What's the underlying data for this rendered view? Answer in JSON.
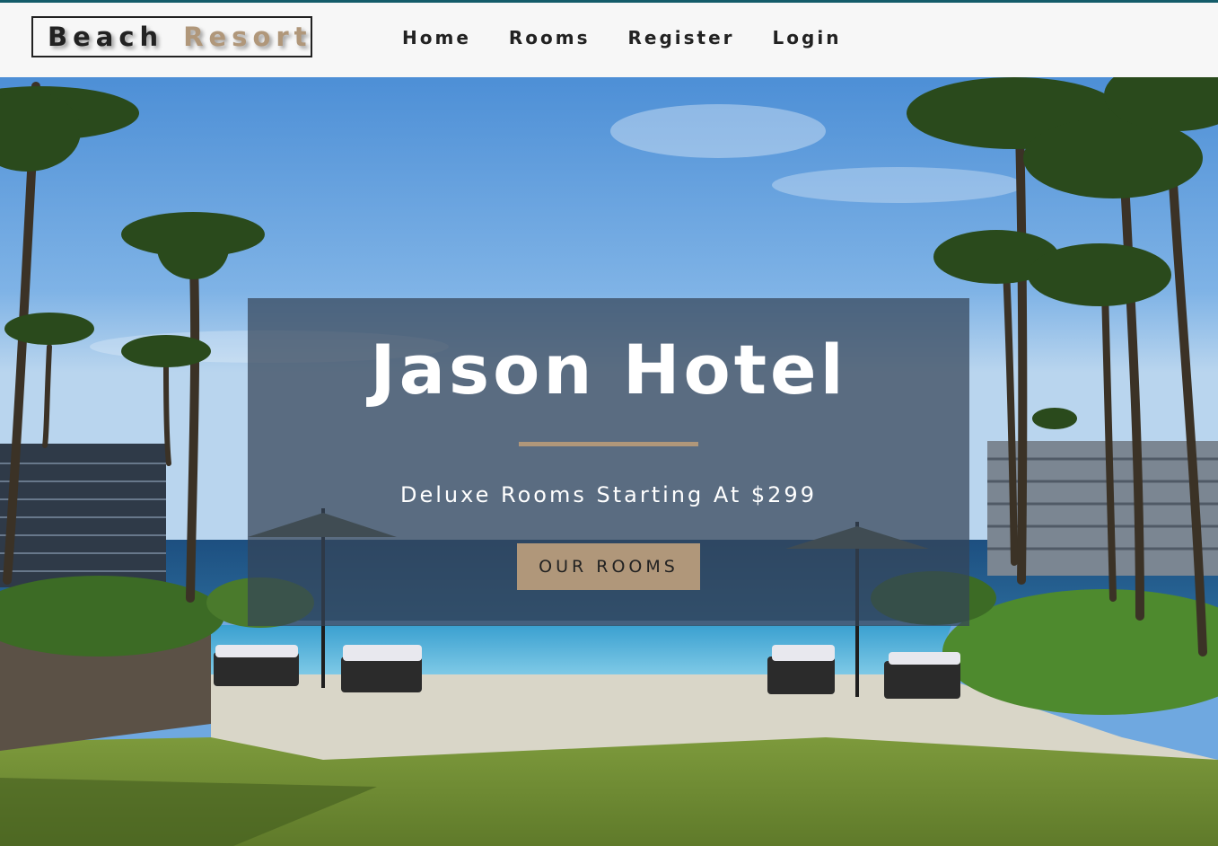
{
  "brand": {
    "word1": "Beach",
    "word2": "Resort"
  },
  "nav": {
    "items": [
      {
        "label": "Home"
      },
      {
        "label": "Rooms"
      },
      {
        "label": "Register"
      },
      {
        "label": "Login"
      }
    ]
  },
  "hero": {
    "title": "Jason Hotel",
    "subtitle": "Deluxe Rooms Starting At $299",
    "button_label": "OUR ROOMS"
  },
  "colors": {
    "accent": "#b0977a",
    "top_strip": "#145c6a",
    "banner_bg": "rgba(52,68,88,0.72)",
    "text_dark": "#222222"
  }
}
